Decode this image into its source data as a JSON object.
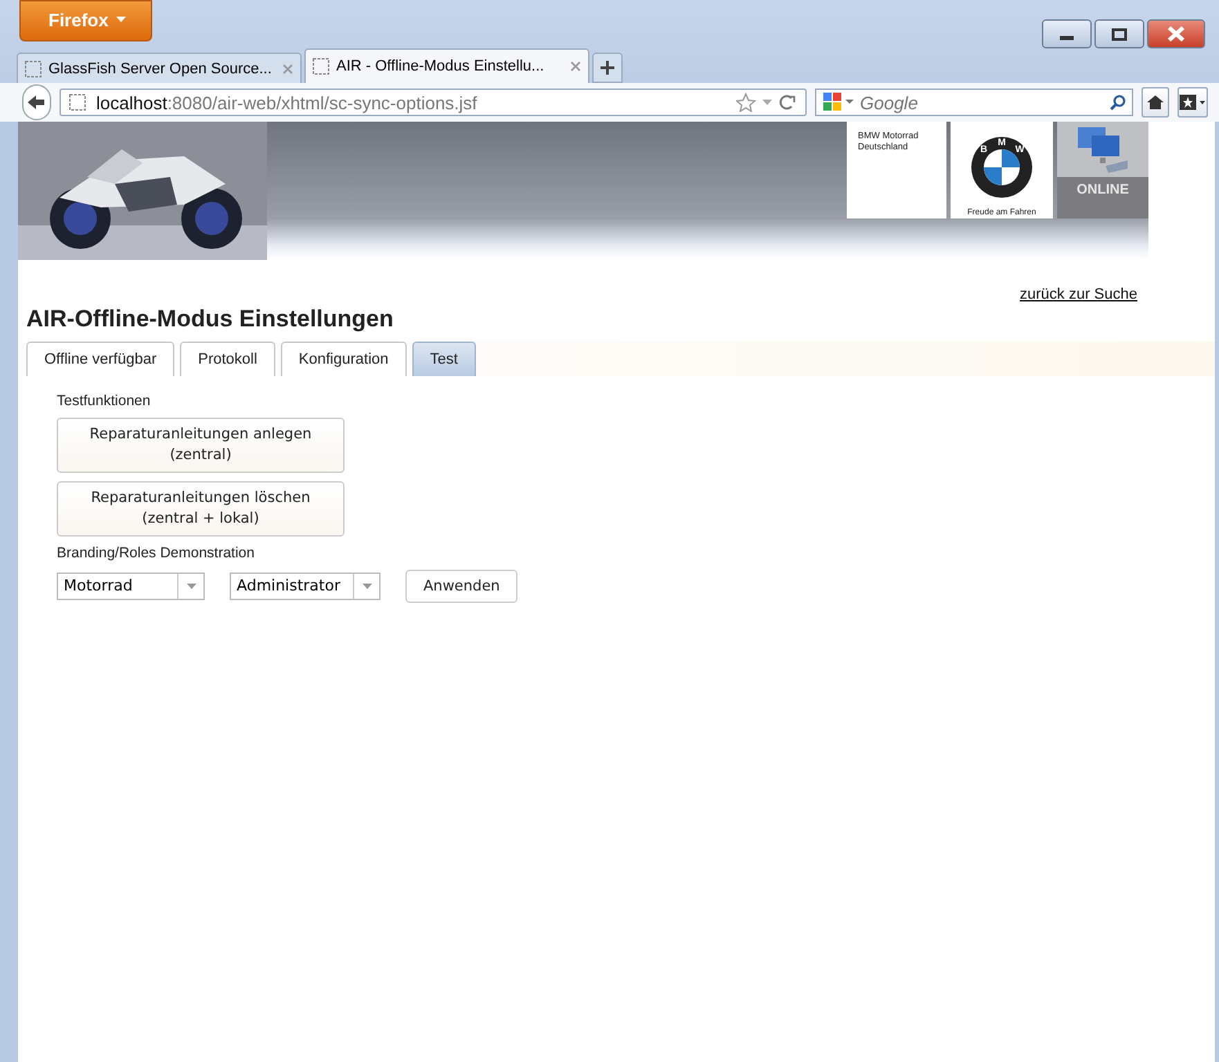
{
  "browser": {
    "menu_button": "Firefox",
    "tabs": [
      {
        "title": "GlassFish Server Open Source...",
        "selected": false
      },
      {
        "title": "AIR - Offline-Modus Einstellu...",
        "selected": true
      }
    ],
    "url_host": "localhost",
    "url_path": ":8080/air-web/xhtml/sc-sync-options.jsf",
    "search_placeholder": "Google"
  },
  "banner": {
    "company": "BMW Motorrad\nDeutschland",
    "logo_letters": [
      "B",
      "M",
      "W"
    ],
    "slogan": "Freude am Fahren",
    "status": "ONLINE"
  },
  "back_link": "zurück zur Suche",
  "page_title": "AIR-Offline-Modus Einstellungen",
  "tabs": [
    {
      "label": "Offline verfügbar",
      "selected": false
    },
    {
      "label": "Protokoll",
      "selected": false
    },
    {
      "label": "Konfiguration",
      "selected": false
    },
    {
      "label": "Test",
      "selected": true
    }
  ],
  "section_label": "Testfunktionen",
  "actions": [
    "Reparaturanleitungen anlegen\n(zentral)",
    "Reparaturanleitungen löschen\n(zentral + lokal)"
  ],
  "demo_label": "Branding/Roles Demonstration",
  "selects": [
    {
      "value": "Motorrad"
    },
    {
      "value": "Administrator"
    }
  ],
  "apply_button": "Anwenden"
}
